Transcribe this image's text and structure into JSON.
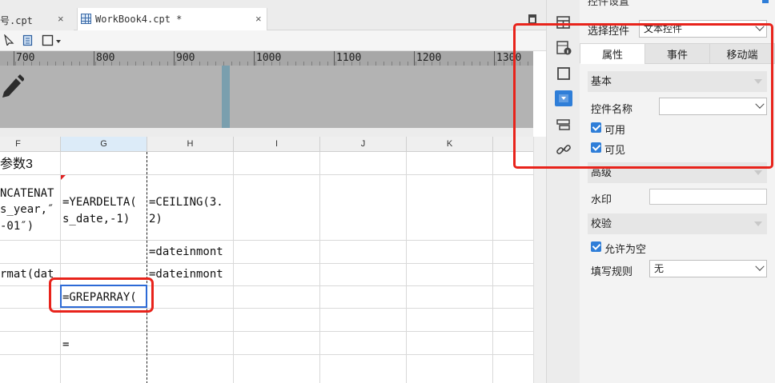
{
  "tabs": [
    {
      "label": "号.cpt",
      "close": "×"
    },
    {
      "label": "WorkBook4.cpt *",
      "close": "×"
    }
  ],
  "ruler": {
    "ticks": [
      "700",
      "800",
      "900",
      "1000",
      "1100",
      "1200",
      "1300"
    ]
  },
  "sheet": {
    "columns": [
      "F",
      "G",
      "H",
      "I",
      "J",
      "K"
    ],
    "selected_column": "G",
    "cells": {
      "f_row1": "参数3",
      "f_row2_l1": "NCATENAT",
      "f_row2_l2": "s_year,″",
      "f_row2_l3": "-01″)",
      "g_row2_l1": "=YEARDELTA(",
      "g_row2_l2": "s_date,-1)",
      "h_row2_l1": "=CEILING(3.",
      "h_row2_l2": "2)",
      "h_row3": "=dateinmont",
      "f_row4": "rmat(dat",
      "h_row4": "=dateinmont",
      "g_row5": "=GREPARRAY(",
      "g_row7": "="
    }
  },
  "panel": {
    "title": "控件设置",
    "select_control_label": "选择控件",
    "select_control_value": "文本控件",
    "tabs": [
      "属性",
      "事件",
      "移动端"
    ],
    "sections": {
      "basic": "基本",
      "advanced": "高级",
      "validate": "校验"
    },
    "control_name_label": "控件名称",
    "control_name_value": "",
    "enabled_label": "可用",
    "visible_label": "可见",
    "watermark_label": "水印",
    "watermark_value": "",
    "allow_empty_label": "允许为空",
    "fill_rule_label": "填写规则",
    "fill_rule_value": "无"
  },
  "colors": {
    "accent": "#2f7ed8",
    "highlight_box": "#e8231b"
  }
}
